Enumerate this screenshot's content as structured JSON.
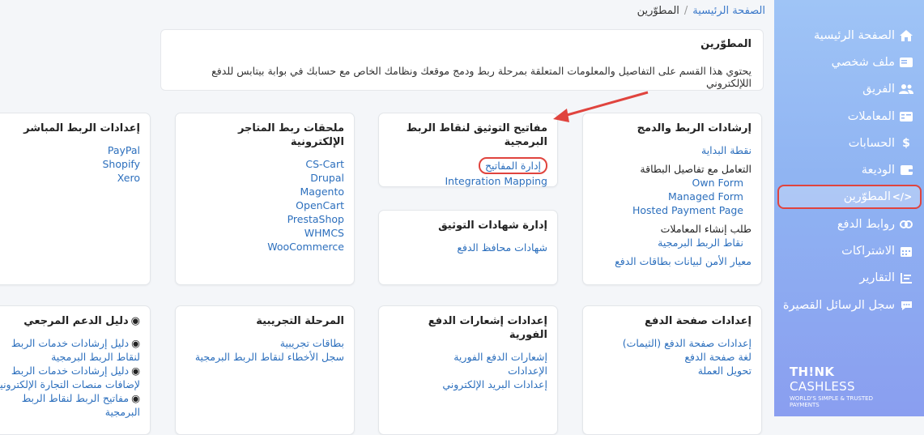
{
  "sidebar": {
    "items": [
      {
        "label": "الصفحة الرئيسية",
        "icon": "home-icon",
        "glyph": "⌂"
      },
      {
        "label": "ملف شخصي",
        "icon": "id-card-icon",
        "glyph": "▤"
      },
      {
        "label": "الفريق",
        "icon": "users-icon",
        "glyph": "👥"
      },
      {
        "label": "المعاملات",
        "icon": "transactions-icon",
        "glyph": "▦"
      },
      {
        "label": "الحسابات",
        "icon": "dollar-icon",
        "glyph": "$"
      },
      {
        "label": "الوديعة",
        "icon": "wallet-icon",
        "glyph": "▣"
      },
      {
        "label": "المطوّرين",
        "icon": "code-icon",
        "glyph": "</>"
      },
      {
        "label": "روابط الدفع",
        "icon": "link-icon",
        "glyph": "∞"
      },
      {
        "label": "الاشتراكات",
        "icon": "calendar-icon",
        "glyph": "▦"
      },
      {
        "label": "التقارير",
        "icon": "reports-icon",
        "glyph": "☰"
      },
      {
        "label": "سجل الرسائل القصيرة",
        "icon": "sms-icon",
        "glyph": "✉"
      }
    ],
    "brand_bold": "TH!NK",
    "brand_rest": "CASHLESS",
    "brand_tagline": "WORLD'S SIMPLE & TRUSTED PAYMENTS"
  },
  "breadcrumb": {
    "home": "الصفحة الرئيسية",
    "separator": "/",
    "current": "المطوّرين"
  },
  "info": {
    "title": "المطوّرين",
    "text": "يحتوي هذا القسم على التفاصيل والمعلومات المتعلقة بمرحلة ربط ودمج موقعك ونظامك الخاص مع حسابك في بوابة بيتابس للدفع اللإلكتروني"
  },
  "cards": {
    "integration": {
      "title": "إرشادات الربط والدمج",
      "start": "نقطة البداية",
      "card_details": "التعامل مع تفاصيل البطاقة",
      "own_form": "Own Form",
      "managed_form": "Managed Form",
      "hosted_page": "Hosted Payment Page",
      "create_tx": "طلب إنشاء المعاملات",
      "api_link": "نقاط الربط البرمجية",
      "pci": "معيار الأمن لبيانات بطاقات الدفع"
    },
    "keys": {
      "title": "مفاتيح التوثيق لنقاط الربط البرمجية",
      "manage": "إدارة المفاتيح",
      "mapping": "Integration Mapping"
    },
    "certs": {
      "title": "إدارة شهادات التوثيق",
      "wallets": "شهادات محافظ الدفع"
    },
    "plugins": {
      "title": "ملحقات ربط المتاجر الإلكترونية",
      "items": [
        "CS-Cart",
        "Drupal",
        "Magento",
        "OpenCart",
        "PrestaShop",
        "WHMCS",
        "WooCommerce"
      ]
    },
    "direct": {
      "title": "إعدادات الربط المباشر",
      "items": [
        "PayPal",
        "Shopify",
        "Xero"
      ]
    },
    "paypage": {
      "title": "إعدادات صفحة الدفع",
      "items": [
        "إعدادات صفحة الدفع (الثيمات)",
        "لغة صفحة الدفع",
        "تحويل العملة"
      ]
    },
    "ipn": {
      "title": "إعدادات إشعارات الدفع الفورية",
      "items": [
        "إشعارات الدفع الفورية",
        "الإعدادات",
        "إعدادات البريد الإلكتروني"
      ]
    },
    "sandbox": {
      "title": "المرحلة التجريبية",
      "items": [
        "بطاقات تجريبية",
        "سجل الأخطاء لنقاط الربط البرمجية"
      ]
    },
    "reference": {
      "title": "دليل الدعم المرجعي",
      "items": [
        "دليل إرشادات خدمات الربط",
        "لنقاط الربط البرمجية",
        "دليل إرشادات خدمات الربط",
        "لإضافات منصات التجارة الإلكترونية",
        "مفاتيح الربط لنقاط الربط",
        "البرمجية"
      ]
    }
  }
}
